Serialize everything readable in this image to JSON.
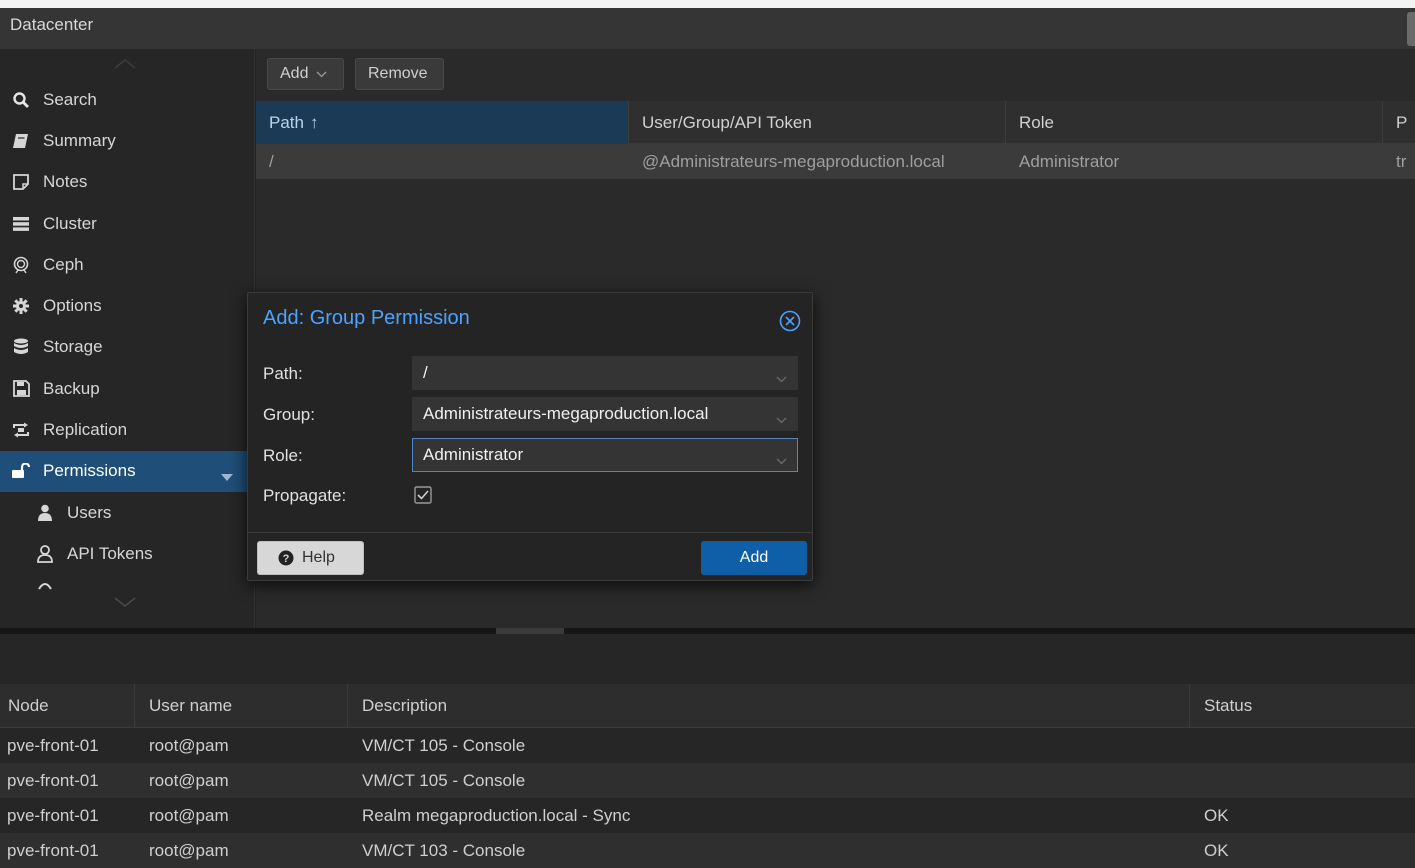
{
  "header": {
    "title": "Datacenter"
  },
  "sidebar": {
    "items": [
      {
        "label": "Search",
        "icon": "search-icon"
      },
      {
        "label": "Summary",
        "icon": "book-icon"
      },
      {
        "label": "Notes",
        "icon": "notes-icon"
      },
      {
        "label": "Cluster",
        "icon": "server-icon"
      },
      {
        "label": "Ceph",
        "icon": "ceph-icon"
      },
      {
        "label": "Options",
        "icon": "gear-icon"
      },
      {
        "label": "Storage",
        "icon": "database-icon"
      },
      {
        "label": "Backup",
        "icon": "floppy-icon"
      },
      {
        "label": "Replication",
        "icon": "replication-icon"
      },
      {
        "label": "Permissions",
        "icon": "unlock-icon",
        "active": true
      },
      {
        "label": "Users",
        "icon": "user-icon"
      },
      {
        "label": "API Tokens",
        "icon": "user-outline-icon"
      }
    ]
  },
  "toolbar": {
    "add_label": "Add",
    "remove_label": "Remove"
  },
  "permissions_grid": {
    "columns": [
      "Path",
      "User/Group/API Token",
      "Role",
      "P"
    ],
    "sort_indicator": "↑",
    "rows": [
      {
        "path": "/",
        "ugid": "@Administrateurs-megaproduction.local",
        "role": "Administrator",
        "propagate": "tr"
      }
    ]
  },
  "dialog": {
    "title": "Add: Group Permission",
    "path_label": "Path:",
    "path_value": "/",
    "group_label": "Group:",
    "group_value": "Administrateurs-megaproduction.local",
    "role_label": "Role:",
    "role_value": "Administrator",
    "propagate_label": "Propagate:",
    "propagate_checked": true,
    "help_label": "Help",
    "add_label": "Add"
  },
  "tasks": {
    "columns": [
      "Node",
      "User name",
      "Description",
      "Status"
    ],
    "rows": [
      {
        "node": "pve-front-01",
        "user": "root@pam",
        "description": "VM/CT 105 - Console",
        "status": ""
      },
      {
        "node": "pve-front-01",
        "user": "root@pam",
        "description": "VM/CT 105 - Console",
        "status": ""
      },
      {
        "node": "pve-front-01",
        "user": "root@pam",
        "description": "Realm megaproduction.local - Sync",
        "status": "OK"
      },
      {
        "node": "pve-front-01",
        "user": "root@pam",
        "description": "VM/CT 103 - Console",
        "status": "OK"
      }
    ]
  },
  "colors": {
    "accent": "#1f4e78",
    "title_blue": "#4aa4ff",
    "primary_button": "#0e5fa8"
  }
}
